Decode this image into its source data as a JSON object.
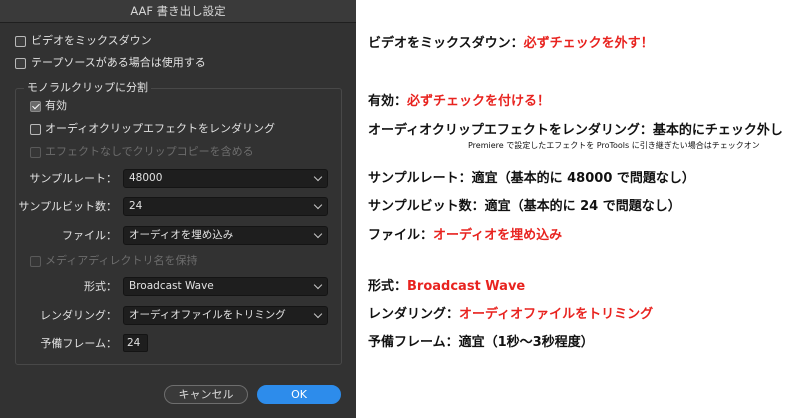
{
  "dialog": {
    "title": "AAF 書き出し設定",
    "mix_video": {
      "label": "ビデオをミックスダウン",
      "checked": false
    },
    "tape_source": {
      "label": "テープソースがある場合は使用する",
      "checked": false
    },
    "mono_group": {
      "title": "モノラルクリップに分割",
      "enable": {
        "label": "有効",
        "checked": true
      },
      "render_effects": {
        "label": "オーディオクリップエフェクトをレンダリング",
        "checked": false
      },
      "copy_no_effect": {
        "label": "エフェクトなしでクリップコピーを含める",
        "checked": false,
        "disabled": true
      },
      "sample_rate": {
        "label": "サンプルレート：",
        "value": "48000"
      },
      "bit_depth": {
        "label": "サンプルビット数：",
        "value": "24"
      },
      "file": {
        "label": "ファイル：",
        "value": "オーディオを埋め込み"
      },
      "keep_dir": {
        "label": "メディアディレクトリ名を保持",
        "checked": false,
        "disabled": true
      },
      "format": {
        "label": "形式：",
        "value": "Broadcast Wave"
      },
      "rendering": {
        "label": "レンダリング：",
        "value": "オーディオファイルをトリミング"
      },
      "handles": {
        "label": "予備フレーム：",
        "value": "24"
      }
    },
    "cancel_label": "キャンセル",
    "ok_label": "OK"
  },
  "notes": {
    "mix": {
      "label": "ビデオをミックスダウン：",
      "value": "必ずチェックを外す！"
    },
    "enable": {
      "label": "有効：",
      "value": "必ずチェックを付ける！"
    },
    "render": {
      "text": "オーディオクリップエフェクトをレンダリング：基本的にチェック外し"
    },
    "render_sub": {
      "text": "Premiere で設定したエフェクトを ProTools に引き継ぎたい場合はチェックオン"
    },
    "sample_rate": {
      "text": "サンプルレート：適宜（基本的に 48000 で問題なし）"
    },
    "bit_depth": {
      "text": "サンプルビット数：適宜（基本的に 24 で問題なし）"
    },
    "file": {
      "label": "ファイル：",
      "value": "オーディオを埋め込み"
    },
    "format": {
      "label": "形式：",
      "value": "Broadcast Wave"
    },
    "rendering": {
      "label": "レンダリング：",
      "value": "オーディオファイルをトリミング"
    },
    "handles": {
      "text": "予備フレーム：適宜（1秒〜3秒程度）"
    }
  },
  "colors": {
    "dialog_bg": "#323232",
    "accent_ok": "#2d8ceb",
    "highlight_red": "#e8231f"
  }
}
